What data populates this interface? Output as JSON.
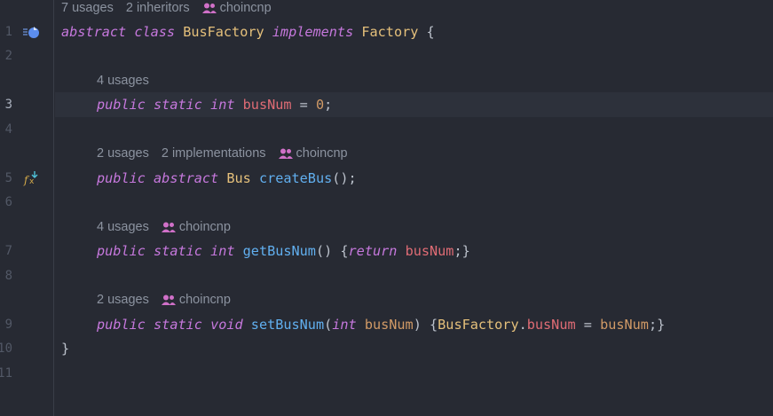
{
  "editor": {
    "language": "java",
    "colors": {
      "background": "#272a33",
      "keyword": "#c678dd",
      "class": "#e5c07b",
      "field": "#e06c75",
      "number": "#d19a66",
      "function": "#61afef",
      "hint": "#8c93a0"
    },
    "line_numbers": [
      "1",
      "2",
      "3",
      "4",
      "5",
      "6",
      "7",
      "8",
      "9",
      "10",
      "11"
    ],
    "active_line": "3",
    "gutter_icons": [
      "implemented-by-icon",
      "implemented-function-icon"
    ],
    "hints": {
      "class_hint": {
        "usages": "7 usages",
        "inheritors": "2 inheritors",
        "author": "choincnp"
      },
      "field_hint": {
        "usages": "4 usages"
      },
      "create_hint": {
        "usages": "2 usages",
        "implementations": "2 implementations",
        "author": "choincnp"
      },
      "get_hint": {
        "usages": "4 usages",
        "author": "choincnp"
      },
      "set_hint": {
        "usages": "2 usages",
        "author": "choincnp"
      }
    },
    "code": {
      "l1": {
        "abstract": "abstract",
        "class": "class",
        "name": "BusFactory",
        "implements": "implements",
        "iface": "Factory",
        "brace": "{"
      },
      "l3": {
        "public": "public",
        "static": "static",
        "int": "int",
        "field": "busNum",
        "eq": " = ",
        "value": "0",
        "semi": ";"
      },
      "l5": {
        "public": "public",
        "abstract": "abstract",
        "type": "Bus",
        "fn": "createBus",
        "rest": "();"
      },
      "l7": {
        "public": "public",
        "static": "static",
        "int": "int",
        "fn": "getBusNum",
        "paren": "() {",
        "ret": "return",
        "field": "busNum",
        "end": ";}"
      },
      "l9": {
        "public": "public",
        "static": "static",
        "void": "void",
        "fn": "setBusNum",
        "open": "(",
        "int": "int",
        "param": "busNum",
        "close": ") {",
        "cls": "BusFactory",
        "dot": ".",
        "field": "busNum",
        "eq": " = ",
        "val": "busNum",
        "end": ";}"
      },
      "l10": {
        "brace": "}"
      }
    }
  }
}
